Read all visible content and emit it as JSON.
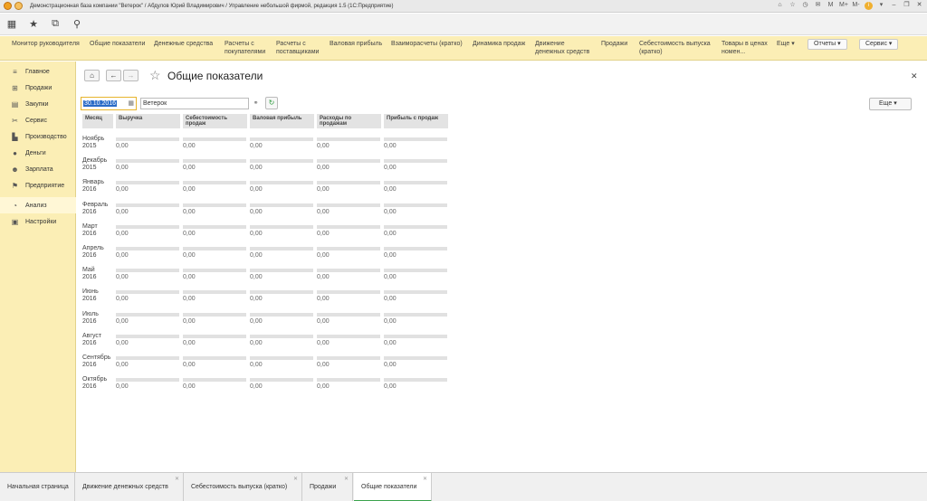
{
  "window": {
    "title": "Демонстрационная база компании \"Ветерок\" / Абдулов Юрий Владимирович / Управление небольшой фирмой, редакция 1.5  (1С:Предприятие)"
  },
  "toolbar": {
    "icons": [
      "apps-icon",
      "favorites-star-icon",
      "history-icon",
      "search-icon"
    ]
  },
  "sections": {
    "items": [
      {
        "label": "Монитор руководителя"
      },
      {
        "label": "Общие показатели"
      },
      {
        "label": "Денежные средства"
      },
      {
        "label": "Расчеты с покупателями"
      },
      {
        "label": "Расчеты с поставщиками"
      },
      {
        "label": "Валовая прибыль"
      },
      {
        "label": "Взаиморасчеты (кратко)"
      },
      {
        "label": "Динамика продаж"
      },
      {
        "label": "Движение денежных средств"
      },
      {
        "label": "Продажи"
      },
      {
        "label": "Себестоимость выпуска (кратко)"
      },
      {
        "label": "Товары в ценах номен..."
      },
      {
        "label": "Еще ▾"
      }
    ],
    "reports_label": "Отчеты ▾",
    "service_label": "Сервис ▾"
  },
  "sidebar": {
    "items": [
      {
        "label": "Главное",
        "icon": "list-icon"
      },
      {
        "label": "Продажи",
        "icon": "basket-icon"
      },
      {
        "label": "Закупки",
        "icon": "cart-icon"
      },
      {
        "label": "Сервис",
        "icon": "tools-icon"
      },
      {
        "label": "Производство",
        "icon": "factory-icon"
      },
      {
        "label": "Деньги",
        "icon": "coin-icon"
      },
      {
        "label": "Зарплата",
        "icon": "people-icon"
      },
      {
        "label": "Предприятие",
        "icon": "flag-icon"
      },
      {
        "label": "Анализ",
        "icon": "chart-icon"
      },
      {
        "label": "Настройки",
        "icon": "settings-icon"
      }
    ],
    "active_index": 8
  },
  "page": {
    "title": "Общие показатели",
    "date": "30.10.2016",
    "organization": "Ветерок",
    "more_label": "Еще ▾"
  },
  "table": {
    "columns": [
      "Месяц",
      "Выручка",
      "Себестоимость продаж",
      "Валовая прибыль",
      "Расходы по продажам",
      "Прибыль с продаж"
    ],
    "rows": [
      {
        "m": "Ноябрь",
        "y": "2015"
      },
      {
        "m": "Декабрь",
        "y": "2015"
      },
      {
        "m": "Январь",
        "y": "2016"
      },
      {
        "m": "Февраль",
        "y": "2016"
      },
      {
        "m": "Март",
        "y": "2016"
      },
      {
        "m": "Апрель",
        "y": "2016"
      },
      {
        "m": "Май",
        "y": "2016"
      },
      {
        "m": "Июнь",
        "y": "2016"
      },
      {
        "m": "Июль",
        "y": "2016"
      },
      {
        "m": "Август",
        "y": "2016"
      },
      {
        "m": "Сентябрь",
        "y": "2016"
      },
      {
        "m": "Октябрь",
        "y": "2016"
      }
    ],
    "cell_value": "0,00"
  },
  "tabs": [
    {
      "label": "Начальная страница",
      "closable": false
    },
    {
      "label": "Движение денежных средств",
      "closable": true
    },
    {
      "label": "Себестоимость выпуска (кратко)",
      "closable": true
    },
    {
      "label": "Продажи",
      "closable": true
    },
    {
      "label": "Общие показатели",
      "closable": true,
      "active": true
    }
  ],
  "colors": {
    "section_bg": "#fbeeb5",
    "accent_green": "#3aa34c",
    "date_border": "#e7b52d"
  }
}
